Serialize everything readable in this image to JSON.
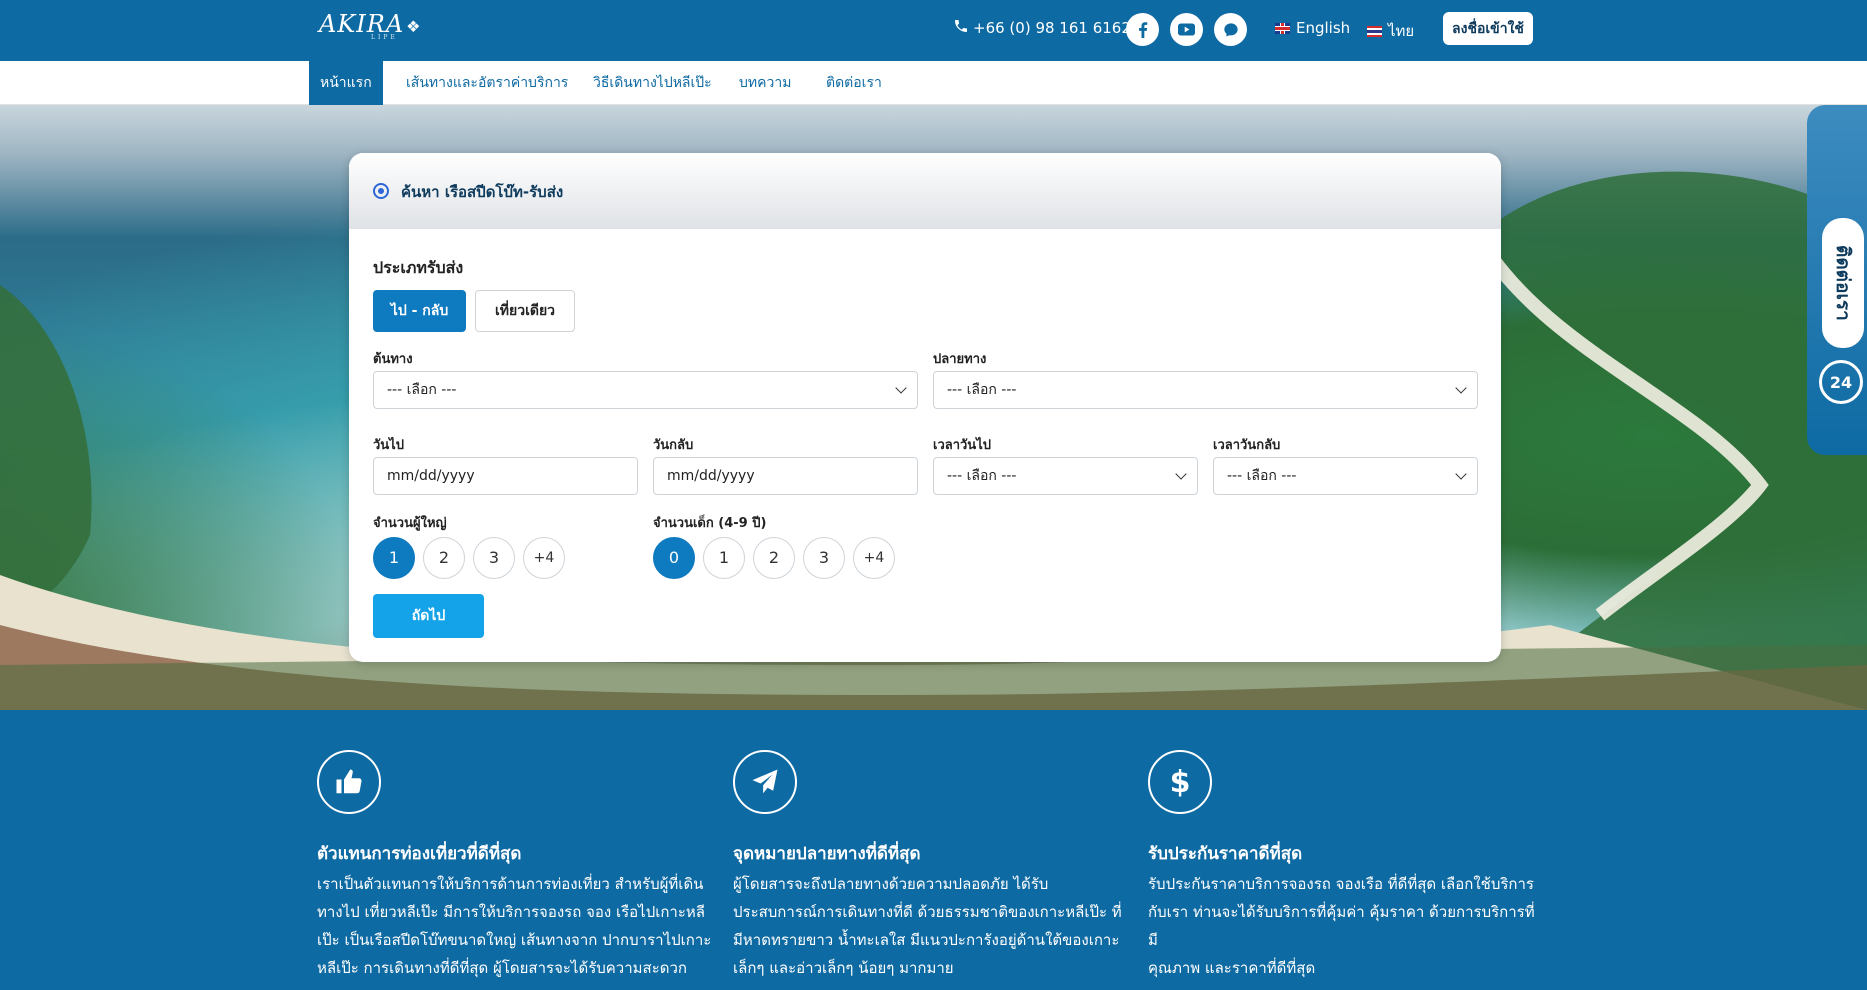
{
  "header": {
    "logo": "AKIRA",
    "logo_sub": "LIPE",
    "phone": "+66 (0) 98 161 6162",
    "lang_en": "English",
    "lang_th": "ไทย",
    "login_label": "ลงชื่อเข้าใช้",
    "social_icons": [
      "facebook-icon",
      "youtube-icon",
      "chat-icon"
    ]
  },
  "nav": {
    "items": [
      {
        "label": "หน้าแรก",
        "active": true
      },
      {
        "label": "เส้นทางและอัตราค่าบริการ"
      },
      {
        "label": "วิธีเดินทางไปหลีเป๊ะ"
      },
      {
        "label": "บทความ"
      },
      {
        "label": "ติดต่อเรา"
      }
    ]
  },
  "side_contact": {
    "label": "ติดต่อเรา",
    "badge": "24"
  },
  "booking": {
    "title": "ค้นหา เรือสปีดโบ๊ท-รับส่ง",
    "type_label": "ประเภทรับส่ง",
    "type_round": "ไป - กลับ",
    "type_oneway": "เที่ยวเดียว",
    "origin_label": "ต้นทาง",
    "origin_value": "--- เลือก ---",
    "dest_label": "ปลายทาง",
    "dest_value": "--- เลือก ---",
    "depart_label": "วันไป",
    "depart_value": "mm/dd/yyyy",
    "return_label": "วันกลับ",
    "return_value": "mm/dd/yyyy",
    "depart_time_label": "เวลาวันไป",
    "depart_time_value": "--- เลือก ---",
    "return_time_label": "เวลาวันกลับ",
    "return_time_value": "--- เลือก ---",
    "adults_label": "จำนวนผู้ใหญ่",
    "adults_options": [
      "1",
      "2",
      "3",
      "+4"
    ],
    "children_label": "จำนวนเด็ก (4-9 ปี)",
    "children_options": [
      "0",
      "1",
      "2",
      "3",
      "+4"
    ],
    "next_label": "ถัดไป"
  },
  "features": [
    {
      "icon": "thumbs-up-icon",
      "title": "ตัวแทนการท่องเที่ยวที่ดีที่สุด",
      "lines": [
        "เราเป็นตัวแทนการให้บริการด้านการท่องเที่ยว สำหรับผู้ที่เดิน",
        "ทางไป เที่ยวหลีเป๊ะ มีการให้บริการจองรถ จอง เรือไปเกาะหลี",
        "เป๊ะ เป็นเรือสปีดโบ๊ทขนาดใหญ่ เส้นทางจาก ปากบาราไปเกาะ",
        "หลีเป๊ะ การเดินทางที่ดีที่สุด ผู้โดยสารจะได้รับความสะดวก"
      ]
    },
    {
      "icon": "paper-plane-icon",
      "title": "จุดหมายปลายทางที่ดีที่สุด",
      "lines": [
        "ผู้โดยสารจะถึงปลายทางด้วยความปลอดภัย ได้รับ",
        "ประสบการณ์การเดินทางที่ดี ด้วยธรรมชาติของเกาะหลีเป๊ะ ที่",
        "มีหาดทรายขาว น้ำทะเลใส มีแนวปะการังอยู่ด้านใต้ของเกาะ",
        "เล็กๆ และอ่าวเล็กๆ น้อยๆ มากมาย"
      ]
    },
    {
      "icon": "dollar-icon",
      "title": "รับประกันราคาดีที่สุด",
      "lines": [
        "รับประกันราคาบริการจองรถ จองเรือ ที่ดีที่สุด เลือกใช้บริการ",
        "กับเรา ท่านจะได้รับบริการที่คุ้มค่า คุ้มราคา ด้วยการบริการที่มี",
        "คุณภาพ และราคาที่ดีที่สุด"
      ]
    }
  ]
}
